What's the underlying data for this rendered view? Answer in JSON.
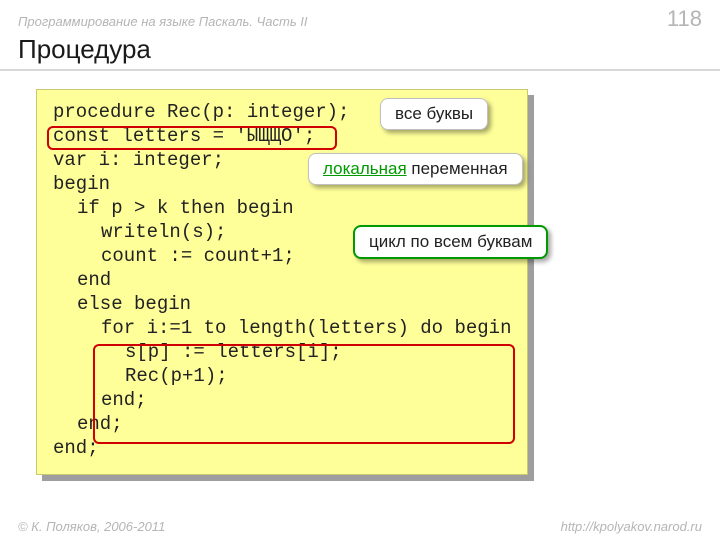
{
  "header": {
    "course": "Программирование на языке Паскаль. Часть II",
    "page_number": "118"
  },
  "title": "Процедура",
  "code": {
    "l1": "procedure Rec(p: integer);",
    "l2": "const letters = 'ЫЩЩО';",
    "l3": "var i: integer;",
    "l4": "begin",
    "l5": "if p > k then begin",
    "l6": "writeln(s);",
    "l7": "count := count+1;",
    "l8": "end",
    "l9": "else begin",
    "l10": "for i:=1 to length(letters) do begin",
    "l11": "s[p] := letters[i];",
    "l12": "Rec(p+1);",
    "l13": "end;",
    "l14": "end;",
    "l15": "end;"
  },
  "callouts": {
    "all_letters": "все буквы",
    "local_prefix": "локальная",
    "local_suffix": " переменная",
    "loop": "цикл по всем буквам"
  },
  "footer": {
    "copyright": "© К. Поляков, 2006-2011",
    "url": "http://kpolyakov.narod.ru"
  }
}
